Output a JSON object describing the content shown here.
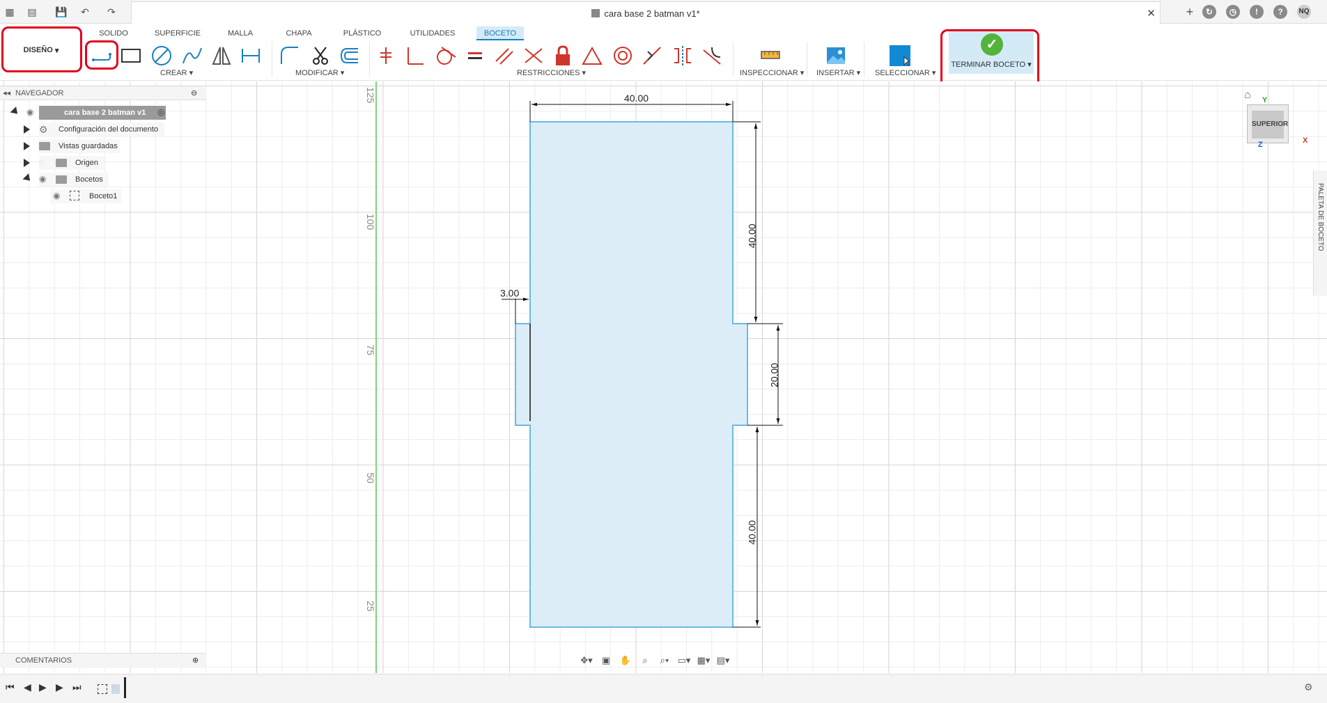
{
  "titlebar": {
    "doc_title": "cara base 2 batman v1*",
    "close_icon": "close-icon",
    "user_initials": "NQ"
  },
  "tabs": [
    {
      "label": "SOLIDO"
    },
    {
      "label": "SUPERFICIE"
    },
    {
      "label": "MALLA"
    },
    {
      "label": "CHAPA"
    },
    {
      "label": "PLÁSTICO"
    },
    {
      "label": "UTILIDADES"
    },
    {
      "label": "BOCETO",
      "active": true
    }
  ],
  "toolbar": {
    "design_label": "DISEÑO",
    "groups": {
      "crear": "CREAR",
      "modificar": "MODIFICAR",
      "restricciones": "RESTRICCIONES",
      "inspeccionar": "INSPECCIONAR",
      "insertar": "INSERTAR",
      "seleccionar": "SELECCIONAR"
    },
    "finish_label": "TERMINAR BOCETO"
  },
  "browser": {
    "title": "NAVEGADOR",
    "root": "cara base 2 batman v1",
    "items": [
      {
        "label": "Configuración del documento",
        "icon": "gear-icon"
      },
      {
        "label": "Vistas guardadas",
        "icon": "folder-icon"
      },
      {
        "label": "Origen",
        "icon": "folder-icon"
      },
      {
        "label": "Bocetos",
        "icon": "folder-icon"
      },
      {
        "label": "Boceto1",
        "icon": "sketch-icon"
      }
    ]
  },
  "comments": {
    "label": "COMENTARIOS"
  },
  "ruler": [
    "125",
    "100",
    "75",
    "50",
    "25"
  ],
  "dimensions": {
    "top_width": "40.00",
    "upper_height": "40.00",
    "middle_height": "20.00",
    "lower_height": "40.00",
    "left_offset": "3.00"
  },
  "viewcube": {
    "face": "SUPERIOR",
    "axes": {
      "y": "Y",
      "x": "X",
      "z": "Z"
    }
  },
  "palette": {
    "label": "PALETA DE BOCETO"
  },
  "colors": {
    "accent": "#1a7ec2",
    "profile_fill": "#dcedf8",
    "profile_stroke": "#6bb8e6",
    "highlight_box": "#e3001b",
    "finish_green": "#54b33a"
  }
}
